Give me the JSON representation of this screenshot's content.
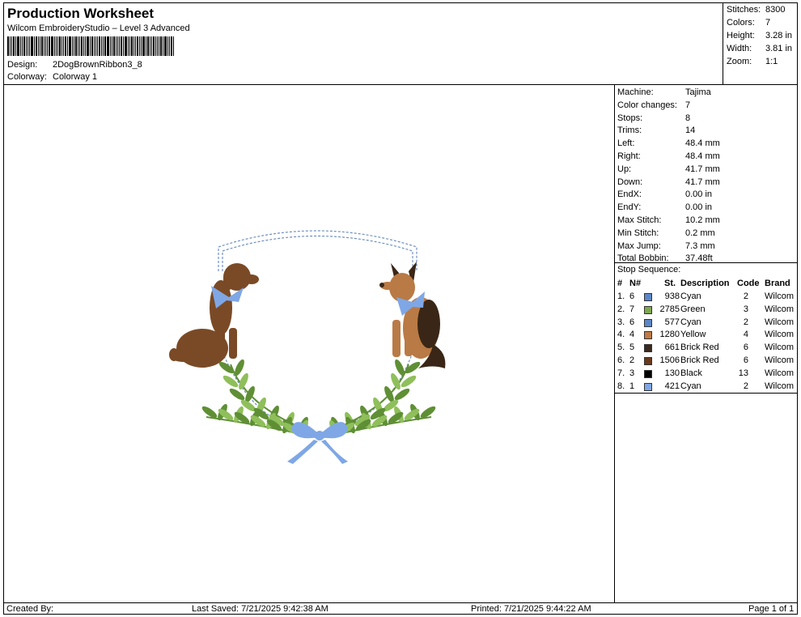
{
  "header": {
    "title": "Production Worksheet",
    "subtitle": "Wilcom EmbroideryStudio – Level 3 Advanced",
    "design_label": "Design:",
    "design_value": "2DogBrownRibbon3_8",
    "colorway_label": "Colorway:",
    "colorway_value": "Colorway 1"
  },
  "summary": {
    "stitches_label": "Stitches:",
    "stitches": "8300",
    "colors_label": "Colors:",
    "colors": "7",
    "height_label": "Height:",
    "height": "3.28 in",
    "width_label": "Width:",
    "width": "3.81 in",
    "zoom_label": "Zoom:",
    "zoom": "1:1"
  },
  "machine": [
    {
      "label": "Machine:",
      "value": "Tajima"
    },
    {
      "label": "Color changes:",
      "value": "7"
    },
    {
      "label": "Stops:",
      "value": "8"
    },
    {
      "label": "Trims:",
      "value": "14"
    },
    {
      "label": "Left:",
      "value": "48.4 mm"
    },
    {
      "label": "Right:",
      "value": "48.4 mm"
    },
    {
      "label": "Up:",
      "value": "41.7 mm"
    },
    {
      "label": "Down:",
      "value": "41.7 mm"
    },
    {
      "label": "EndX:",
      "value": "0.00 in"
    },
    {
      "label": "EndY:",
      "value": "0.00 in"
    },
    {
      "label": "Max Stitch:",
      "value": "10.2 mm"
    },
    {
      "label": "Min Stitch:",
      "value": "0.2 mm"
    },
    {
      "label": "Max Jump:",
      "value": "7.3 mm"
    },
    {
      "label": "Total Bobbin:",
      "value": "37.48ft"
    }
  ],
  "stop_sequence": {
    "title": "Stop Sequence:",
    "headers": {
      "num": "#",
      "n": "N#",
      "st": "St.",
      "desc": "Description",
      "code": "Code",
      "brand": "Brand"
    },
    "rows": [
      {
        "num": "1.",
        "n": "6",
        "st": "938",
        "desc": "Cyan",
        "code": "2",
        "brand": "Wilcom",
        "color": "#5b87c9"
      },
      {
        "num": "2.",
        "n": "7",
        "st": "2785",
        "desc": "Green",
        "code": "3",
        "brand": "Wilcom",
        "color": "#7fa84f"
      },
      {
        "num": "3.",
        "n": "6",
        "st": "577",
        "desc": "Cyan",
        "code": "2",
        "brand": "Wilcom",
        "color": "#5b87c9"
      },
      {
        "num": "4.",
        "n": "4",
        "st": "1280",
        "desc": "Yellow",
        "code": "4",
        "brand": "Wilcom",
        "color": "#c07a45"
      },
      {
        "num": "5.",
        "n": "5",
        "st": "661",
        "desc": "Brick Red",
        "code": "6",
        "brand": "Wilcom",
        "color": "#3a2a1e"
      },
      {
        "num": "6.",
        "n": "2",
        "st": "1506",
        "desc": "Brick Red",
        "code": "6",
        "brand": "Wilcom",
        "color": "#6a3a1c"
      },
      {
        "num": "7.",
        "n": "3",
        "st": "130",
        "desc": "Black",
        "code": "13",
        "brand": "Wilcom",
        "color": "#000000"
      },
      {
        "num": "8.",
        "n": "1",
        "st": "421",
        "desc": "Cyan",
        "code": "2",
        "brand": "Wilcom",
        "color": "#7fa7e6"
      }
    ]
  },
  "footer": {
    "created_by": "Created By:",
    "last_saved": "Last Saved: 7/21/2025 9:42:38 AM",
    "printed": "Printed: 7/21/2025 9:44:22 AM",
    "page": "Page 1 of 1"
  },
  "design_colors": {
    "brown_dog": "#7a4a26",
    "shepherd_light": "#b97a45",
    "shepherd_dark": "#3a2616",
    "leaf": "#8fbf5a",
    "leaf_dark": "#5f8f35",
    "ribbon": "#7fa7e6",
    "outline": "#6f8fc4"
  }
}
